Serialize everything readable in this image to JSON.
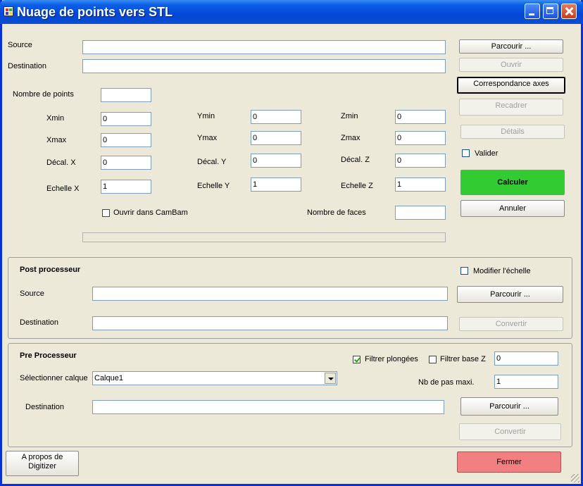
{
  "window": {
    "title": "Nuage de points vers STL"
  },
  "main": {
    "source_label": "Source",
    "source_value": "",
    "destination_label": "Destination",
    "destination_value": "",
    "nb_points_label": "Nombre de points",
    "nb_points_value": "",
    "xmin_label": "Xmin",
    "xmin_value": "0",
    "xmax_label": "Xmax",
    "xmax_value": "0",
    "decal_x_label": "Décal. X",
    "decal_x_value": "0",
    "echelle_x_label": "Echelle X",
    "echelle_x_value": "1",
    "ymin_label": "Ymin",
    "ymin_value": "0",
    "ymax_label": "Ymax",
    "ymax_value": "0",
    "decal_y_label": "Décal. Y",
    "decal_y_value": "0",
    "echelle_y_label": "Echelle Y",
    "echelle_y_value": "1",
    "zmin_label": "Zmin",
    "zmin_value": "0",
    "zmax_label": "Zmax",
    "zmax_value": "0",
    "decal_z_label": "Décal. Z",
    "decal_z_value": "0",
    "echelle_z_label": "Echelle Z",
    "echelle_z_value": "1",
    "ouvrir_camBam_label": "Ouvrir dans CamBam",
    "ouvrir_camBam_checked": false,
    "nb_faces_label": "Nombre de faces",
    "nb_faces_value": "",
    "progress": 0
  },
  "right": {
    "parcourir_label": "Parcourir ...",
    "ouvrir_label": "Ouvrir",
    "correspondance_label": "Correspondance axes",
    "recadrer_label": "Recadrer",
    "details_label": "Détails",
    "valider_label": "Valider",
    "valider_checked": false,
    "calculer_label": "Calculer",
    "annuler_label": "Annuler"
  },
  "post": {
    "title": "Post processeur",
    "modifier_echelle_label": "Modifier l'échelle",
    "modifier_echelle_checked": false,
    "source_label": "Source",
    "source_value": "",
    "destination_label": "Destination",
    "destination_value": "",
    "parcourir_label": "Parcourir ...",
    "convertir_label": "Convertir"
  },
  "pre": {
    "title": "Pre Processeur",
    "filtrer_plongees_label": "Filtrer plongées",
    "filtrer_plongees_checked": true,
    "filtrer_base_z_label": "Filtrer base Z",
    "filtrer_base_z_checked": false,
    "base_z_value": "0",
    "calque_label": "Sélectionner calque",
    "calque_value": "Calque1",
    "nb_pas_label": "Nb de pas maxi.",
    "nb_pas_value": "1",
    "destination_label": "Destination",
    "destination_value": "",
    "parcourir_label": "Parcourir ...",
    "convertir_label": "Convertir"
  },
  "footer": {
    "apropos_line1": "A propos de",
    "apropos_line2": "Digitizer",
    "fermer_label": "Fermer"
  }
}
